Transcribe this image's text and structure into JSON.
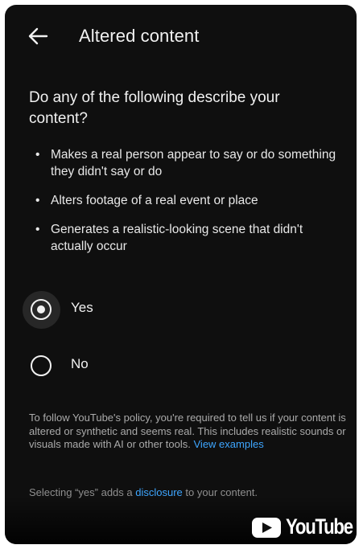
{
  "header": {
    "back_icon": "arrow-left-icon",
    "title": "Altered content"
  },
  "question": "Do any of the following describe your content?",
  "bullets": [
    "Makes a real person appear to say or do something they didn't say or do",
    "Alters footage of a real event or place",
    "Generates a realistic-looking scene that didn't actually occur"
  ],
  "options": [
    {
      "label": "Yes",
      "selected": true
    },
    {
      "label": "No",
      "selected": false
    }
  ],
  "policy": {
    "text": "To follow YouTube's policy, you're required to tell us if your content is altered or synthetic and seems real. This includes realistic sounds or visuals made with AI or other tools.",
    "link": "View examples"
  },
  "disclosure_note": {
    "before": "Selecting “yes” adds a",
    "link": "disclosure",
    "after": "to your content."
  },
  "watermark": {
    "icon": "youtube-play-icon",
    "text": "YouTube"
  },
  "colors": {
    "background": "#0f0f0f",
    "text": "#f1f1f1",
    "secondary_text": "#aaaaaa",
    "link": "#3ea6ff"
  }
}
